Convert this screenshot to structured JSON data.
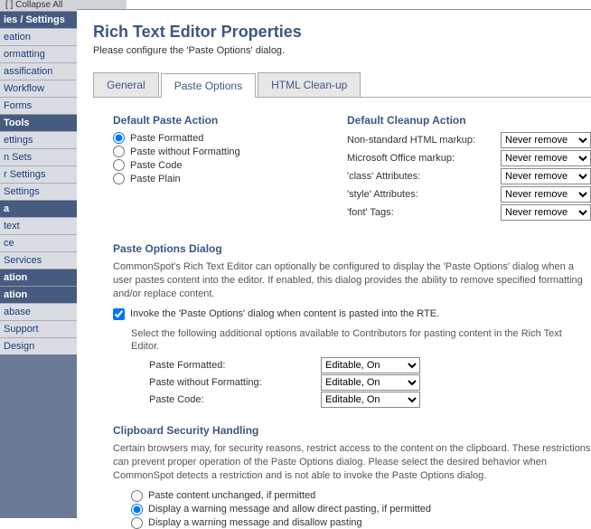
{
  "top_bar_text": "[ ] Collapse All",
  "sidebar": {
    "groups": [
      {
        "header": "ies / Settings",
        "items": [
          "eation",
          "ormatting",
          "assification",
          "Workflow",
          "Forms"
        ]
      },
      {
        "header": "Tools",
        "items": [
          "ettings",
          "n Sets",
          "r Settings",
          "Settings"
        ]
      },
      {
        "header": "a",
        "items": [
          "text",
          "ce",
          "Services"
        ]
      },
      {
        "header": "ation",
        "items": []
      },
      {
        "header": "ation",
        "items": [
          "abase",
          "Support",
          "Design"
        ]
      }
    ]
  },
  "title": "Rich Text Editor Properties",
  "subtitle": "Please configure the 'Paste Options' dialog.",
  "tabs": {
    "general": "General",
    "paste": "Paste Options",
    "html": "HTML Clean-up"
  },
  "default_paste": {
    "title": "Default Paste Action",
    "opts": [
      "Paste Formatted",
      "Paste without Formatting",
      "Paste Code",
      "Paste Plain"
    ],
    "selected": 0
  },
  "default_cleanup": {
    "title": "Default Cleanup Action",
    "rows": [
      {
        "label": "Non-standard HTML markup:",
        "value": "Never remove"
      },
      {
        "label": "Microsoft Office markup:",
        "value": "Never remove"
      },
      {
        "label": "'class' Attributes:",
        "value": "Never remove"
      },
      {
        "label": "'style' Attributes:",
        "value": "Never remove"
      },
      {
        "label": "'font' Tags:",
        "value": "Never remove"
      }
    ]
  },
  "paste_dialog": {
    "title": "Paste Options Dialog",
    "desc": "CommonSpot's Rich Text Editor can optionally be configured to display the 'Paste Options' dialog when a user pastes content into the editor. If enabled, this dialog provides the ability to remove specified formatting and/or replace content.",
    "cb_label": "Invoke the 'Paste Options' dialog when content is pasted into the RTE.",
    "sub_desc": "Select the following additional options available to Contributors for pasting content in the Rich Text Editor.",
    "rows": [
      {
        "label": "Paste Formatted:",
        "value": "Editable, On"
      },
      {
        "label": "Paste without Formatting:",
        "value": "Editable, On"
      },
      {
        "label": "Paste Code:",
        "value": "Editable, On"
      }
    ]
  },
  "clipboard": {
    "title": "Clipboard Security Handling",
    "desc": "Certain browsers may, for security reasons, restrict access to the content on the clipboard. These restrictions can prevent proper operation of the Paste Options dialog. Please select the desired behavior when CommonSpot detects a restriction and is not able to invoke the Paste Options dialog.",
    "opts": [
      "Paste content unchanged, if permitted",
      "Display a warning message and allow direct pasting, if permitted",
      "Display a warning message and disallow pasting"
    ],
    "selected": 1
  }
}
